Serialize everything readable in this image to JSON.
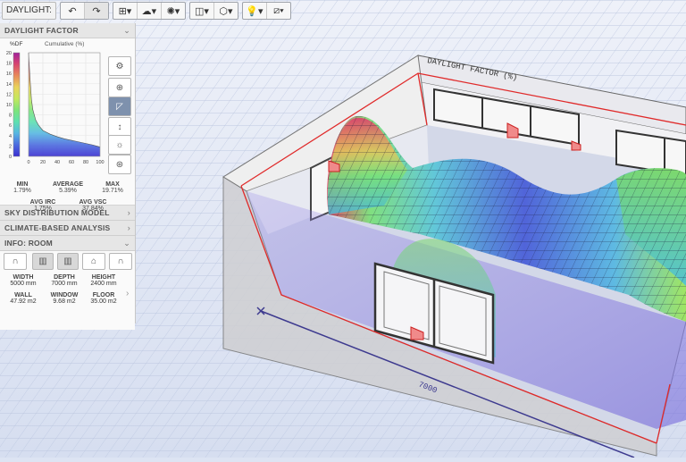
{
  "toolbar": {
    "mode_label": "DAYLIGHT:",
    "icons": [
      "undo-icon",
      "redo-icon",
      "grid-view-icon",
      "sky-icon",
      "sun-settings-icon",
      "camera-view-icon",
      "box-view-icon",
      "light-bulb-icon",
      "analysis-grid-icon"
    ]
  },
  "panel": {
    "daylight_factor": {
      "title": "DAYLIGHT FACTOR",
      "chart_ylabel": "%DF",
      "chart_title": "Cumulative (%)",
      "yticks": [
        "20",
        "18",
        "16",
        "14",
        "12",
        "10",
        "8",
        "6",
        "4",
        "2",
        "0"
      ],
      "xticks": [
        "0",
        "20",
        "40",
        "60",
        "80",
        "100"
      ],
      "min_label": "MIN",
      "min_value": "1.79%",
      "avg_label": "AVERAGE",
      "avg_value": "5.39%",
      "max_label": "MAX",
      "max_value": "19.71%",
      "irc_label": "AVG IRC",
      "irc_value": "1.75%",
      "vsc_label": "AVG VSC",
      "vsc_value": "37.84%"
    },
    "sky_distribution_model": {
      "title": "SKY DISTRIBUTION MODEL"
    },
    "climate_based_analysis": {
      "title": "CLIMATE-BASED ANALYSIS"
    },
    "info_room": {
      "title": "INFO: ROOM",
      "width_label": "WIDTH",
      "width_value": "5000 mm",
      "depth_label": "DEPTH",
      "depth_value": "7000 mm",
      "height_label": "HEIGHT",
      "height_value": "2400 mm",
      "wall_label": "WALL",
      "wall_value": "47.92 m2",
      "window_label": "WINDOW",
      "window_value": "9.68 m2",
      "floor_label": "FLOOR",
      "floor_value": "35.00 m2"
    }
  },
  "viewport": {
    "surface_label": "DAYLIGHT FACTOR (%)",
    "dimension_label": "7000"
  },
  "chart_data": {
    "type": "area",
    "title": "Cumulative (%)",
    "ylabel": "%DF",
    "xlabel": "",
    "xlim": [
      0,
      100
    ],
    "ylim": [
      0,
      20
    ],
    "x": [
      0,
      2,
      4,
      6,
      8,
      10,
      14,
      20,
      30,
      40,
      50,
      60,
      70,
      80,
      90,
      95,
      100
    ],
    "y": [
      20,
      15,
      11,
      9,
      8,
      7,
      6,
      5,
      4.3,
      3.8,
      3.4,
      3.1,
      2.8,
      2.5,
      2.2,
      2.0,
      1.8
    ],
    "colormap": [
      "#3a2fd0",
      "#4c6bdf",
      "#57b6e2",
      "#5ee0b0",
      "#7de47a",
      "#c3e85e",
      "#e9d35a",
      "#e88a5a",
      "#d8456f",
      "#a2219b"
    ]
  }
}
